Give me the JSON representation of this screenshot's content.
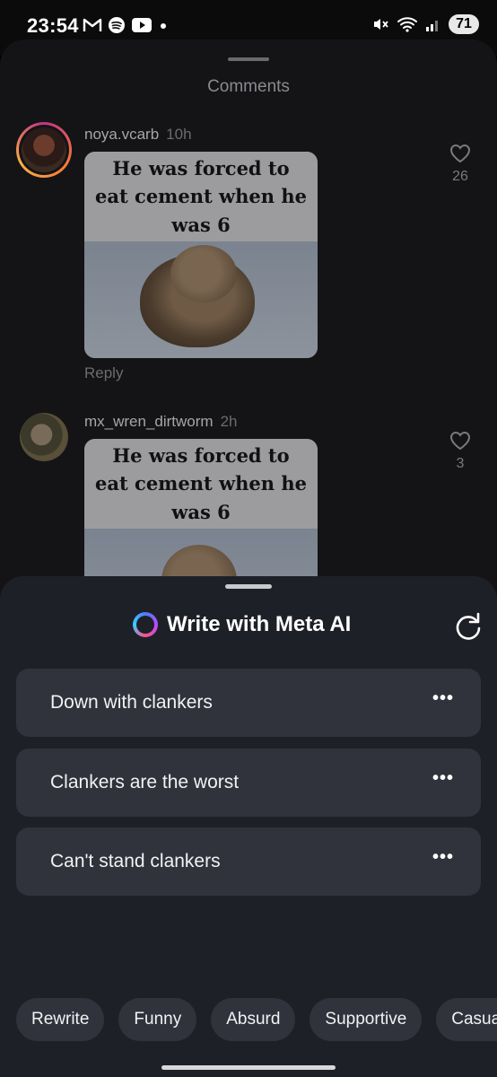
{
  "status_bar": {
    "time": "23:54",
    "battery": "71",
    "app_icons": [
      "gmail-icon",
      "spotify-icon",
      "youtube-icon",
      "dot-icon"
    ],
    "right_icons": [
      "mute-icon",
      "wifi-icon",
      "signal-icon"
    ]
  },
  "comments": {
    "title": "Comments",
    "items": [
      {
        "username": "noya.vcarb",
        "time": "10h",
        "meme_caption": "He was forced to eat cement when he was 6",
        "reply_label": "Reply",
        "likes": "26"
      },
      {
        "username": "mx_wren_dirtworm",
        "time": "2h",
        "meme_caption": "He was forced to eat cement when he was 6",
        "likes": "3"
      }
    ]
  },
  "meta_ai": {
    "title": "Write with Meta AI",
    "suggestions": [
      {
        "text": "Down with clankers",
        "more": "•••"
      },
      {
        "text": "Clankers are the worst",
        "more": "•••"
      },
      {
        "text": "Can't stand clankers",
        "more": "•••"
      }
    ],
    "chips": [
      "Rewrite",
      "Funny",
      "Absurd",
      "Supportive",
      "Casual"
    ]
  },
  "colors": {
    "background": "#000000",
    "comments_sheet": "#141416",
    "ai_sheet": "#1e2027",
    "card": "#30333c",
    "muted_text": "#8a8a8f"
  }
}
